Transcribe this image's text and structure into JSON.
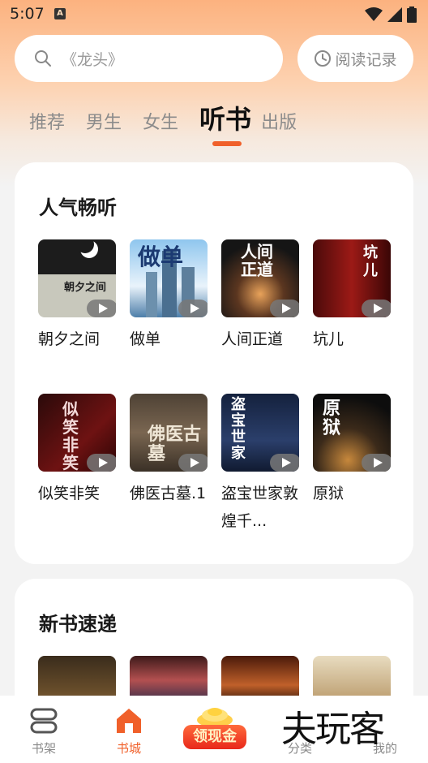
{
  "status": {
    "time": "5:07",
    "a_icon": "A"
  },
  "search": {
    "placeholder": "《龙头》"
  },
  "history": {
    "label": "阅读记录"
  },
  "tabs": [
    {
      "label": "推荐"
    },
    {
      "label": "男生"
    },
    {
      "label": "女生"
    },
    {
      "label": "听书"
    },
    {
      "label": "出版"
    }
  ],
  "hot": {
    "title": "人气畅听",
    "books": [
      {
        "name": "朝夕之间",
        "cover_text": "朝夕之间"
      },
      {
        "name": "做单",
        "cover_text": "做单"
      },
      {
        "name": "人间正道",
        "cover_text": "人间正道"
      },
      {
        "name": "坑儿",
        "cover_text": "坑儿"
      },
      {
        "name": "似笑非笑",
        "cover_text": "似笑非笑"
      },
      {
        "name": "佛医古墓.1",
        "cover_text": "佛医古墓"
      },
      {
        "name": "盗宝世家敦煌千...",
        "cover_text": "盗宝世家"
      },
      {
        "name": "原狱",
        "cover_text": "原狱"
      }
    ]
  },
  "new_books": {
    "title": "新书速递"
  },
  "nav": {
    "shelf": "书架",
    "store": "书城",
    "coin": "领现金",
    "category": "分类",
    "mine": "我的"
  },
  "watermark": "夫玩客",
  "colors": {
    "accent": "#f0602a",
    "bg_gradient_top": "#fcb27f"
  }
}
